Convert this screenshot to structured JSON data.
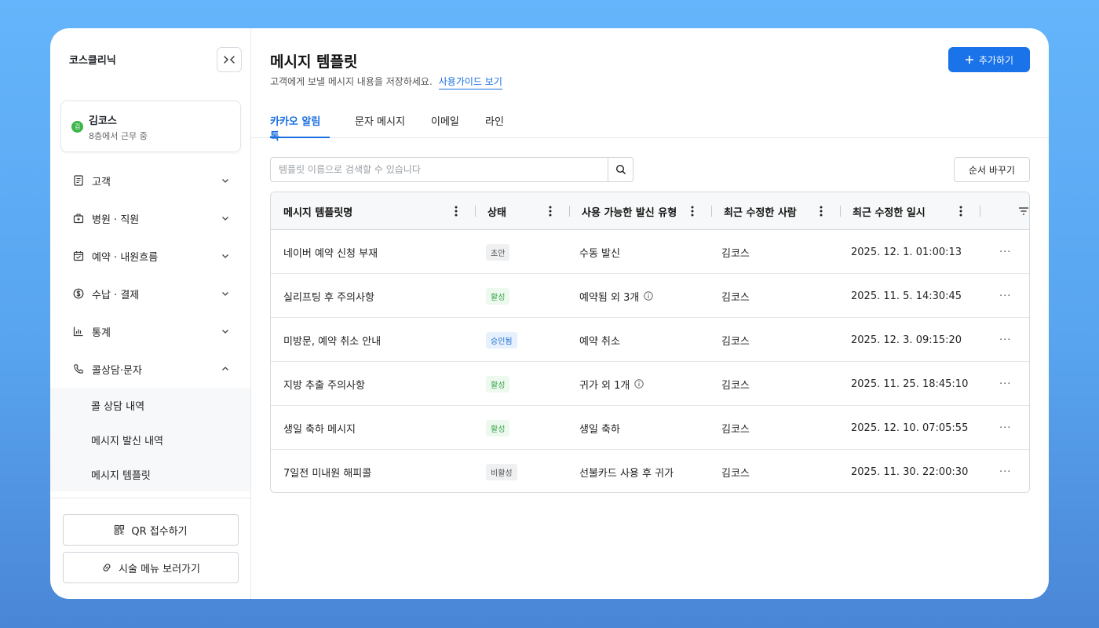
{
  "sidebar": {
    "brand": "코스클리닉",
    "user": {
      "name": "김코스",
      "avatar_initial": "김",
      "status": "8층에서 근무 중"
    },
    "nav": [
      {
        "label": "고객",
        "icon": "receipt-icon",
        "expanded": false
      },
      {
        "label": "병원 · 직원",
        "icon": "hospital-icon",
        "expanded": false
      },
      {
        "label": "예약 · 내원흐름",
        "icon": "calendar-icon",
        "expanded": false
      },
      {
        "label": "수납 · 결제",
        "icon": "dollar-icon",
        "expanded": false
      },
      {
        "label": "통계",
        "icon": "chart-icon",
        "expanded": false
      },
      {
        "label": "콜상담·문자",
        "icon": "phone-icon",
        "expanded": true
      }
    ],
    "sub_items": [
      "콜 상담 내역",
      "메시지 발신 내역",
      "메시지 템플릿"
    ],
    "qr_button": "QR 접수하기",
    "menu_button": "시술 메뉴 보러가기"
  },
  "main": {
    "title": "메시지 템플릿",
    "description": "고객에게 보낼 메시지 내용을 저장하세요.",
    "guide_link": "사용가이드 보기",
    "add_button": "추가하기",
    "tabs": [
      "카카오 알림톡",
      "문자 메시지",
      "이메일",
      "라인"
    ],
    "active_tab": "카카오 알림톡",
    "search_placeholder": "템플릿 이름으로 검색할 수 있습니다",
    "order_button": "순서 바꾸기",
    "columns": [
      "메시지 템플릿명",
      "상태",
      "사용 가능한 발신 유형",
      "최근 수정한 사람",
      "최근 수정한 일시"
    ],
    "rows": [
      {
        "name": "네이버 예약 신청 부재",
        "status": "초안",
        "type": "수동 발신",
        "info": false,
        "editor": "김코스",
        "date": "2025. 12. 1. 01:00:13"
      },
      {
        "name": "실리프팅 후 주의사항",
        "status": "활성",
        "type": "예약됨 외 3개",
        "info": true,
        "editor": "김코스",
        "date": "2025. 11. 5. 14:30:45"
      },
      {
        "name": "미방문, 예약 취소 안내",
        "status": "승인됨",
        "type": "예약 취소",
        "info": false,
        "editor": "김코스",
        "date": "2025. 12. 3. 09:15:20"
      },
      {
        "name": "지방 추출 주의사항",
        "status": "활성",
        "type": "귀가 외 1개",
        "info": true,
        "editor": "김코스",
        "date": "2025. 11. 25. 18:45:10"
      },
      {
        "name": "생일 축하 메시지",
        "status": "활성",
        "type": "생일 축하",
        "info": false,
        "editor": "김코스",
        "date": "2025. 12. 10. 07:05:55"
      },
      {
        "name": "7일전 미내원 해피콜",
        "status": "비활성",
        "type": "선불카드 사용 후 귀가",
        "info": false,
        "editor": "김코스",
        "date": "2025. 11. 30. 22:00:30"
      }
    ]
  },
  "colors": {
    "accent": "#1a73e8",
    "active_green": "#35a447",
    "approved_blue": "#1f6fd1",
    "background": "#64b5fb"
  }
}
